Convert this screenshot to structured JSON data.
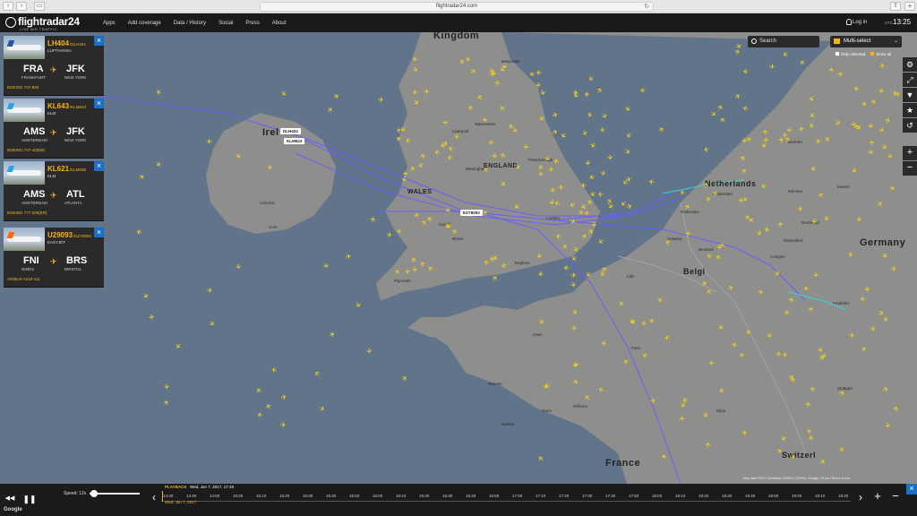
{
  "browser": {
    "url": "flightradar24.com",
    "back_glyph": "‹",
    "forward_glyph": "›",
    "sidebar_glyph": "▭",
    "reload_glyph": "↻",
    "share_glyph": "⇪",
    "plus_glyph": "+"
  },
  "header": {
    "logo_text": "flightradar24",
    "logo_sub": "LIVE AIR TRAFFIC",
    "nav": [
      "Apps",
      "Add coverage",
      "Data / History",
      "Social",
      "Press",
      "About"
    ],
    "login_label": "Log in",
    "utc_label": "UTC",
    "clock": "13:25"
  },
  "map": {
    "labels": {
      "kingdom": "Kingdom",
      "ireland": "Irel",
      "netherlands": "Netherlands",
      "belgium": "Belgi",
      "germany": "Germany",
      "france": "France",
      "switzerland": "Switzerl",
      "wales": "WALES",
      "england": "ENGLAND"
    },
    "cities": [
      "Newcastle",
      "Liverpool",
      "Manchester",
      "Birmingham",
      "Peterborough",
      "London",
      "Cardiff",
      "Bristol",
      "Plymouth",
      "Brighton",
      "Amsterdam",
      "Rotterdam",
      "Antwerp",
      "Brussels",
      "Lille",
      "Paris",
      "Nantes",
      "Rennes",
      "Caen",
      "Orléans",
      "Tours",
      "Dijon",
      "Cologne",
      "Düsseldorf",
      "Dortmund",
      "Frankfurt",
      "Stuttgart",
      "Münster",
      "Kassel",
      "Bremen",
      "Limerick",
      "Cork"
    ],
    "flight_tags": [
      "DLH404",
      "KLM643",
      "EZY8093"
    ]
  },
  "flights": [
    {
      "callsign": "LH404",
      "code": "/DLH404",
      "airline": "LUFTHANSA",
      "from_code": "FRA",
      "from_city": "FRANKFURT",
      "to_code": "JFK",
      "to_city": "NEW YORK",
      "aircraft": "BOEING 747-830"
    },
    {
      "callsign": "KL643",
      "code": "/KLM643",
      "airline": "KLM",
      "from_code": "AMS",
      "from_city": "AMSTERDAM",
      "to_code": "JFK",
      "to_city": "NEW YORK",
      "aircraft": "BOEING 747-406(M)"
    },
    {
      "callsign": "KL621",
      "code": "/KLM036",
      "airline": "KLM",
      "from_code": "AMS",
      "from_city": "AMSTERDAM",
      "to_code": "ATL",
      "to_city": "ATLANTA",
      "aircraft": "BOEING 777-206(ER)"
    },
    {
      "callsign": "U29093",
      "code": "/EZY8093",
      "airline": "EASYJET",
      "from_code": "FNI",
      "from_city": "NIMES",
      "to_code": "BRS",
      "to_city": "BRISTOL",
      "aircraft": "AIRBUS A319-111"
    }
  ],
  "controls": {
    "search_label": "Search",
    "multiselect_label": "Multi-select",
    "multiselect_caret": "⌄",
    "only_selected": "Only selected",
    "show_all": "Show all",
    "close_glyph": "×",
    "zoom_in_glyph": "+",
    "zoom_out_glyph": "−",
    "tools": [
      "⚙",
      "⤢",
      "▼",
      "★",
      "↺"
    ]
  },
  "playback": {
    "rewind_glyph": "◀◀",
    "pause_glyph": "❚❚",
    "left_arrow": "‹",
    "right_arrow": "›",
    "speed_label": "Speed: 12x",
    "speed_fraction": 0.05,
    "tag": "PLAYBACK",
    "date": "Wed, Jun 7, 2017, 17:19",
    "current_date": "Wed, Jun 7, 2017",
    "ticks": [
      "14:30",
      "14:40",
      "14:50",
      "15:00",
      "15:10",
      "15:20",
      "15:30",
      "15:40",
      "15:50",
      "16:00",
      "16:10",
      "16:20",
      "16:30",
      "16:40",
      "16:50",
      "17:00",
      "17:10",
      "17:20",
      "17:30",
      "17:40",
      "17:50",
      "18:00",
      "18:10",
      "18:20",
      "18:30",
      "18:40",
      "18:50",
      "19:00",
      "19:10",
      "19:20"
    ]
  },
  "attribution": "Map data ©2017 GeoBasis-DE/BKG (©2009), Google  |  10 km  |  Terms of Use",
  "google_logo": "Google"
}
